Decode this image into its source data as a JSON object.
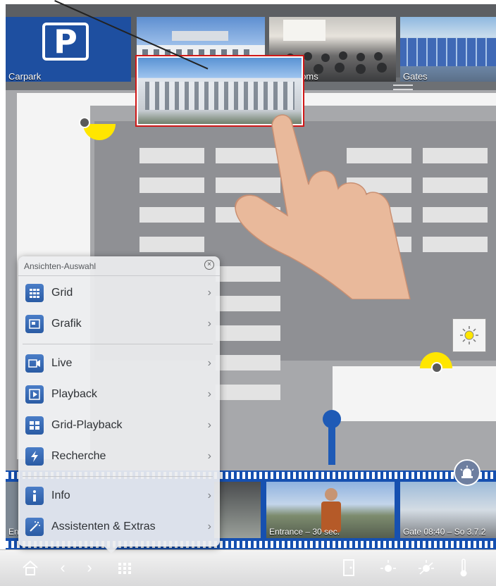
{
  "top_cameras": [
    {
      "label": "Carpark"
    },
    {
      "label": ""
    },
    {
      "label": "nce Rooms"
    },
    {
      "label": "Gates"
    }
  ],
  "timeline_cameras": [
    {
      "label": "Ent"
    },
    {
      "label": ""
    },
    {
      "label": "Entrance – 30 sec."
    },
    {
      "label": "Gate 08:40 – So 3.7.2"
    }
  ],
  "menu": {
    "title": "Ansichten-Auswahl",
    "items": [
      {
        "label": "Grid",
        "icon": "grid-icon"
      },
      {
        "label": "Grafik",
        "icon": "graphic-icon"
      },
      {
        "label": "Live",
        "icon": "camera-icon"
      },
      {
        "label": "Playback",
        "icon": "play-icon"
      },
      {
        "label": "Grid-Playback",
        "icon": "grid-playback-icon"
      },
      {
        "label": "Recherche",
        "icon": "lightning-icon"
      },
      {
        "label": "Info",
        "icon": "info-icon"
      },
      {
        "label": "Assistenten & Extras",
        "icon": "magic-wand-icon"
      }
    ]
  },
  "colors": {
    "accent_blue": "#1650b0",
    "menu_icon_blue": "#2a5ba4",
    "camera_marker_yellow": "#ffe600",
    "selection_red": "#d01818"
  }
}
